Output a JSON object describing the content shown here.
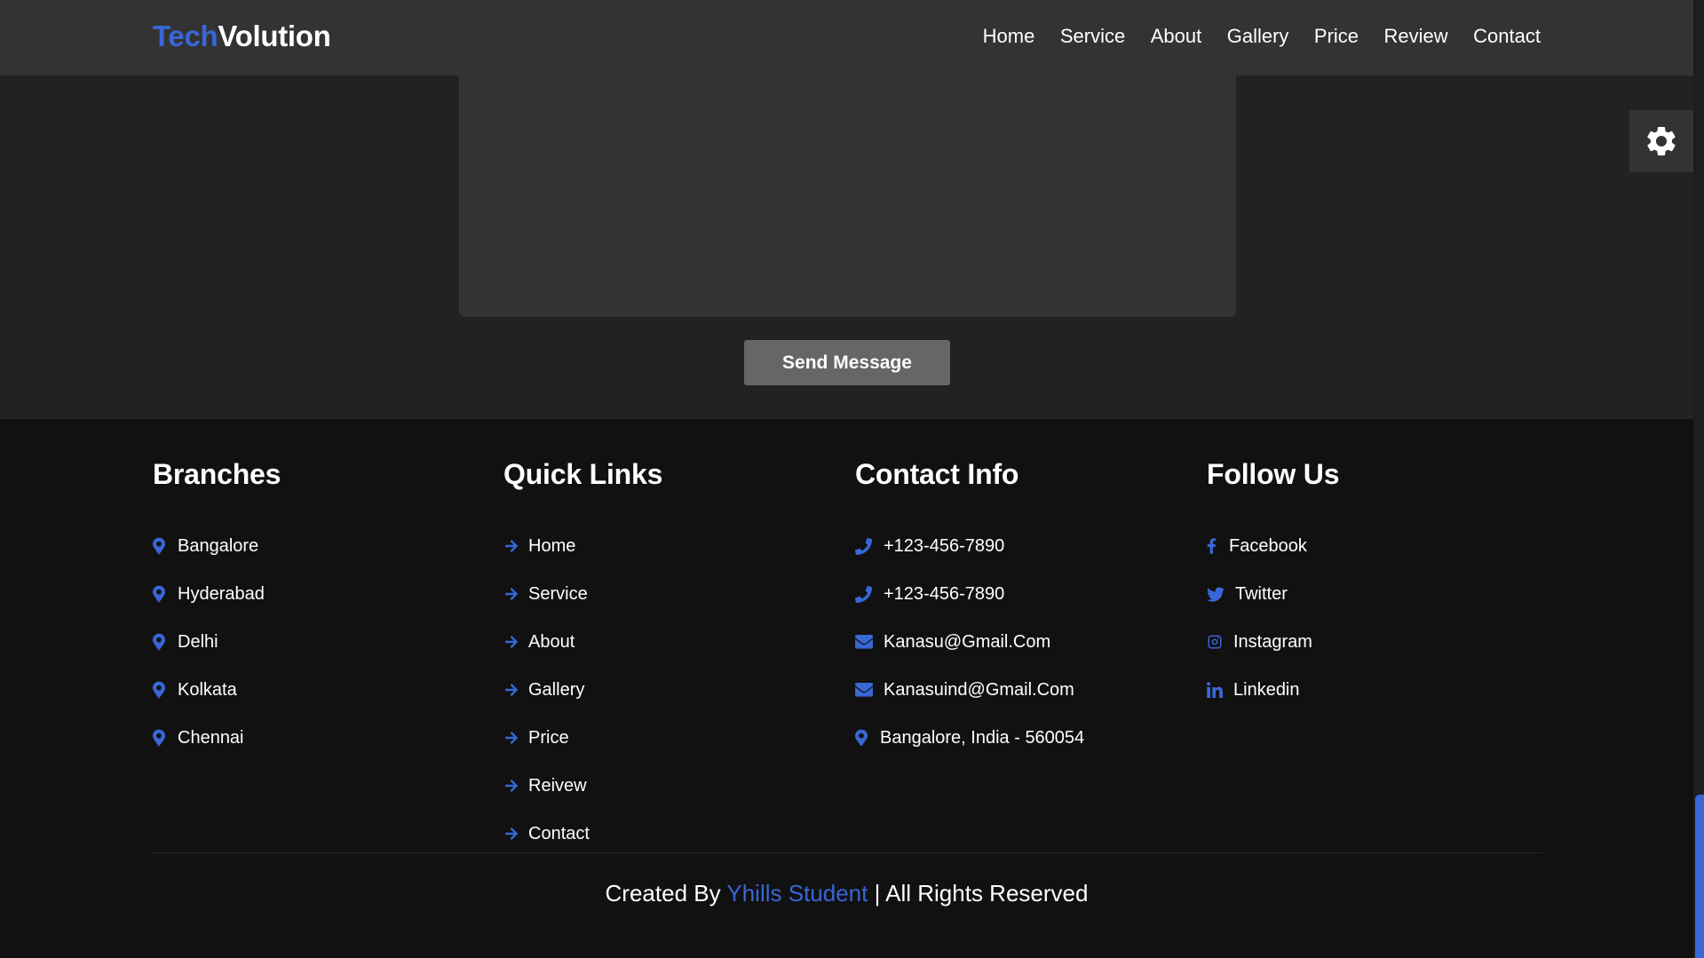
{
  "header": {
    "logo_part1": "Tech",
    "logo_part2": "Volution",
    "nav": [
      "Home",
      "Service",
      "About",
      "Gallery",
      "Price",
      "Review",
      "Contact"
    ]
  },
  "contact_form": {
    "message_value": "",
    "send_label": "Send Message"
  },
  "footer": {
    "branches": {
      "title": "Branches",
      "items": [
        "Bangalore",
        "Hyderabad",
        "Delhi",
        "Kolkata",
        "Chennai"
      ]
    },
    "quick_links": {
      "title": "Quick Links",
      "items": [
        "Home",
        "Service",
        "About",
        "Gallery",
        "Price",
        "Reivew",
        "Contact"
      ]
    },
    "contact_info": {
      "title": "Contact Info",
      "items": [
        {
          "icon": "phone-icon",
          "text": "+123-456-7890"
        },
        {
          "icon": "phone-icon",
          "text": "+123-456-7890"
        },
        {
          "icon": "envelope-icon",
          "text": "Kanasu@Gmail.Com"
        },
        {
          "icon": "envelope-icon",
          "text": "Kanasuind@Gmail.Com"
        },
        {
          "icon": "map-marker-icon",
          "text": "Bangalore, India - 560054"
        }
      ]
    },
    "follow_us": {
      "title": "Follow Us",
      "items": [
        {
          "icon": "facebook-icon",
          "text": "Facebook"
        },
        {
          "icon": "twitter-icon",
          "text": "Twitter"
        },
        {
          "icon": "instagram-icon",
          "text": "Instagram"
        },
        {
          "icon": "linkedin-icon",
          "text": "Linkedin"
        }
      ]
    },
    "credit": {
      "prefix": "Created By",
      "brand": "Yhills Student",
      "suffix": "| All Rights Reserved"
    }
  },
  "colors": {
    "accent": "#3867d6",
    "header_bg": "#333333",
    "section_bg": "#222222",
    "footer_bg": "#111111",
    "button_bg": "#666666"
  },
  "icons": {
    "settings": "gear-icon",
    "branch": "map-marker-icon",
    "quick_link": "arrow-right-icon"
  }
}
